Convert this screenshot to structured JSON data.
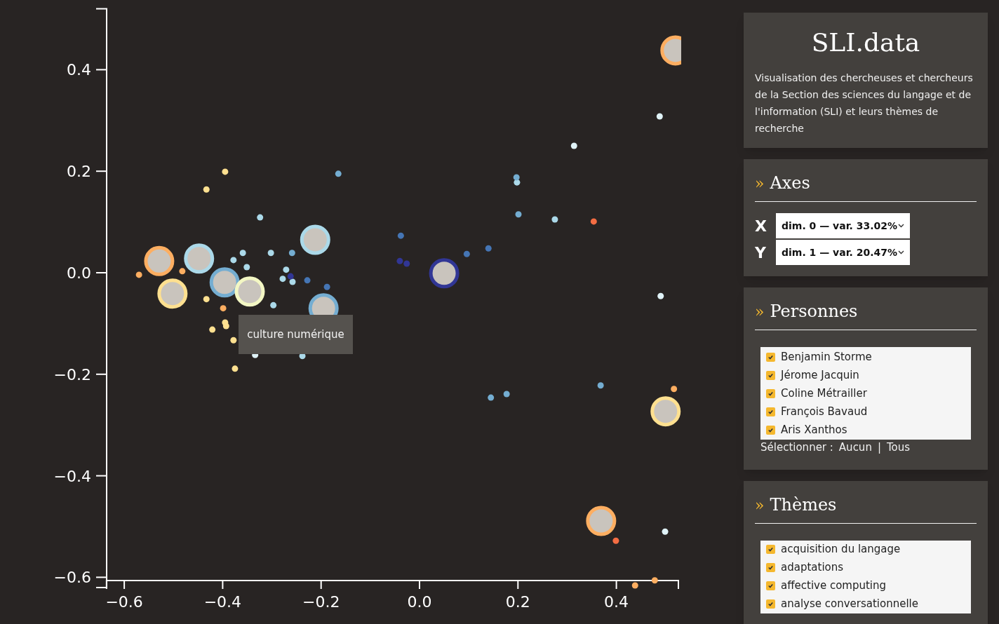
{
  "chart": {
    "chart_data": {
      "type": "scatter",
      "xlim": [
        -0.636,
        0.526
      ],
      "ylim": [
        -0.62,
        0.52
      ],
      "xticks": [
        {
          "value": -0.6,
          "label": "−0.6"
        },
        {
          "value": -0.4,
          "label": "−0.4"
        },
        {
          "value": -0.2,
          "label": "−0.2"
        },
        {
          "value": 0,
          "label": "0.0"
        },
        {
          "value": 0.2,
          "label": "0.2"
        },
        {
          "value": 0.4,
          "label": "0.4"
        }
      ],
      "yticks": [
        {
          "value": 0.4,
          "label": "0.4"
        },
        {
          "value": 0.2,
          "label": "0.2"
        },
        {
          "value": 0,
          "label": "0.0"
        },
        {
          "value": -0.2,
          "label": "−0.2"
        },
        {
          "value": -0.4,
          "label": "−0.4"
        },
        {
          "value": -0.6,
          "label": "−0.6"
        }
      ],
      "series": [
        {
          "color": "#fdae61",
          "x": [
            -0.57,
            -0.482,
            -0.399,
            0.517,
            0.438,
            0.478
          ],
          "values": [
            -0.004,
            0.003,
            -0.07,
            -0.229,
            -0.616,
            -0.606
          ]
        },
        {
          "color": "#fee090",
          "x": [
            -0.433,
            -0.395,
            -0.433,
            -0.421,
            -0.395,
            -0.393,
            -0.378,
            -0.375
          ],
          "values": [
            0.164,
            0.199,
            -0.052,
            -0.112,
            -0.098,
            -0.105,
            -0.133,
            -0.189
          ]
        },
        {
          "color": "#e0f3f8",
          "x": [
            0.488,
            0.314,
            0.49,
            0.499,
            -0.334
          ],
          "values": [
            0.308,
            0.25,
            -0.046,
            -0.51,
            -0.162
          ]
        },
        {
          "color": "#abd9e9",
          "x": [
            -0.324,
            -0.378,
            -0.359,
            -0.302,
            -0.351,
            -0.297,
            -0.278,
            -0.271,
            -0.258,
            0.198,
            0.275,
            -0.238
          ],
          "values": [
            0.109,
            0.025,
            0.039,
            0.039,
            0.011,
            -0.064,
            -0.012,
            0.006,
            -0.018,
            0.178,
            0.105,
            -0.164
          ]
        },
        {
          "color": "#74add1",
          "x": [
            -0.165,
            0.197,
            0.201,
            0.177,
            0.145,
            0.368,
            -0.259
          ],
          "values": [
            0.195,
            0.188,
            0.115,
            -0.239,
            -0.246,
            -0.222,
            0.039
          ]
        },
        {
          "color": "#4575b4",
          "x": [
            -0.038,
            0.096,
            0.14,
            -0.228,
            -0.188
          ],
          "values": [
            0.073,
            0.037,
            0.048,
            -0.015,
            -0.028
          ]
        },
        {
          "color": "#313695",
          "x": [
            -0.04,
            -0.026,
            -0.262
          ],
          "values": [
            0.023,
            0.018,
            -0.007
          ]
        },
        {
          "color": "#f46d43",
          "x": [
            0.354,
            0.399
          ],
          "values": [
            0.101,
            -0.528
          ]
        },
        {
          "marker": "circle",
          "color": "#fdae61",
          "x": [
            -0.529,
            0.369,
            0.52
          ],
          "values": [
            0.023,
            -0.489,
            0.438
          ]
        },
        {
          "marker": "circle",
          "color": "#abd9e9",
          "x": [
            -0.448,
            -0.212
          ],
          "values": [
            0.028,
            0.065
          ]
        },
        {
          "marker": "circle",
          "color": "#fee090",
          "x": [
            -0.502,
            0.5
          ],
          "values": [
            -0.041,
            -0.273
          ]
        },
        {
          "marker": "circle",
          "color": "#74add1",
          "x": [
            -0.396,
            -0.195
          ],
          "values": [
            -0.019,
            -0.07
          ]
        },
        {
          "marker": "circle",
          "color": "#f3f7c4",
          "x": [
            -0.345
          ],
          "values": [
            -0.037
          ]
        },
        {
          "marker": "circle",
          "color": "#313695",
          "x": [
            0.05
          ],
          "values": [
            -0.001
          ]
        }
      ]
    },
    "tooltip": "culture numérique"
  },
  "header": {
    "title": "SLI.data",
    "description": "Visualisation des chercheuses et chercheurs de la Section des sciences du langage et de l'information (SLI) et leurs thèmes de recherche"
  },
  "axes": {
    "marker": "»",
    "title": "Axes",
    "fields": [
      {
        "label": "X",
        "value": "dim. 0 — var. 33.02%"
      },
      {
        "label": "Y",
        "value": "dim. 1 — var. 20.47%"
      }
    ]
  },
  "persons": {
    "marker": "»",
    "title": "Personnes",
    "items": [
      {
        "label": "Benjamin Storme",
        "checked": true
      },
      {
        "label": "Jérome Jacquin",
        "checked": true
      },
      {
        "label": "Coline Métrailler",
        "checked": true
      },
      {
        "label": "François Bavaud",
        "checked": true
      },
      {
        "label": "Aris Xanthos",
        "checked": true
      }
    ],
    "select_label": "Sélectionner :",
    "none_link": "Aucun",
    "separator": "|",
    "all_link": "Tous"
  },
  "themes": {
    "marker": "»",
    "title": "Thèmes",
    "items": [
      {
        "label": "acquisition du langage",
        "checked": true
      },
      {
        "label": "adaptations",
        "checked": true
      },
      {
        "label": "affective computing",
        "checked": true
      },
      {
        "label": "analyse conversationnelle",
        "checked": true
      }
    ]
  }
}
